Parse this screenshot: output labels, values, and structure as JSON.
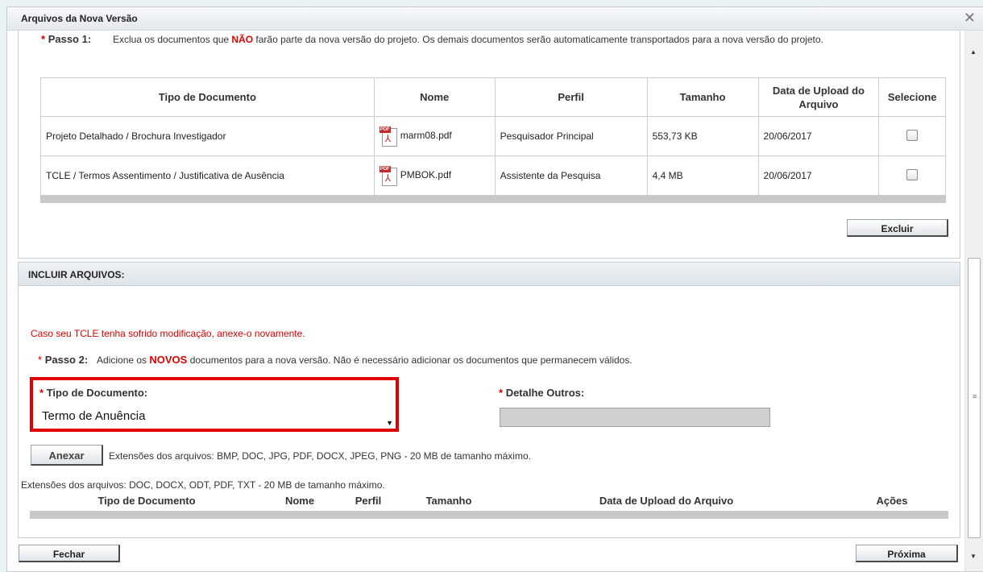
{
  "dialog": {
    "title": "Arquivos da Nova Versão",
    "close_glyph": "✕"
  },
  "step1": {
    "marker": "*",
    "label": "Passo 1:",
    "text_before": "Exclua os documentos que ",
    "text_emph": "NÃO",
    "text_after": " farão parte da nova versão do projeto. Os demais documentos serão automaticamente transportados para a nova versão do projeto.",
    "columns": [
      "Tipo de Documento",
      "Nome",
      "Perfil",
      "Tamanho",
      "Data de Upload do Arquivo",
      "Selecione"
    ],
    "rows": [
      {
        "tipo": "Projeto Detalhado / Brochura Investigador",
        "nome": "marm08.pdf",
        "perfil": "Pesquisador Principal",
        "tamanho": "553,73 KB",
        "data": "20/06/2017",
        "checked": false
      },
      {
        "tipo": "TCLE / Termos Assentimento / Justificativa de Ausência",
        "nome": "PMBOK.pdf",
        "perfil": "Assistente da Pesquisa",
        "tamanho": "4,4 MB",
        "data": "20/06/2017",
        "checked": false
      }
    ],
    "pdf_tag": "PDF",
    "delete_button": "Excluir"
  },
  "include": {
    "header": "INCLUIR ARQUIVOS:",
    "warning": "Caso seu TCLE tenha sofrido modificação, anexe-o novamente.",
    "step2": {
      "marker": "*",
      "label": "Passo 2:",
      "text_before": "Adicione os ",
      "text_emph": "NOVOS",
      "text_after": " documentos para a nova versão. Não é necessário adicionar os documentos que permanecem válidos."
    },
    "tipo_label": "Tipo de Documento:",
    "tipo_value": "Termo de Anuência",
    "detalhe_label": "Detalhe Outros:",
    "detalhe_value": "",
    "attach_button": "Anexar",
    "attach_extensions": "Extensões dos arquivos: BMP, DOC, JPG, PDF, DOCX, JPEG, PNG - 20 MB de tamanho máximo.",
    "extensions_note": "Extensões dos arquivos: DOC, DOCX, ODT, PDF, TXT - 20 MB de tamanho máximo.",
    "columns": [
      "Tipo de Documento",
      "Nome",
      "Perfil",
      "Tamanho",
      "Data de Upload do Arquivo",
      "Ações"
    ]
  },
  "footer": {
    "close_button": "Fechar",
    "next_button": "Próxima"
  },
  "colors": {
    "required": "#d50000",
    "warning": "#e00000",
    "highlight_box": "#e00000"
  }
}
